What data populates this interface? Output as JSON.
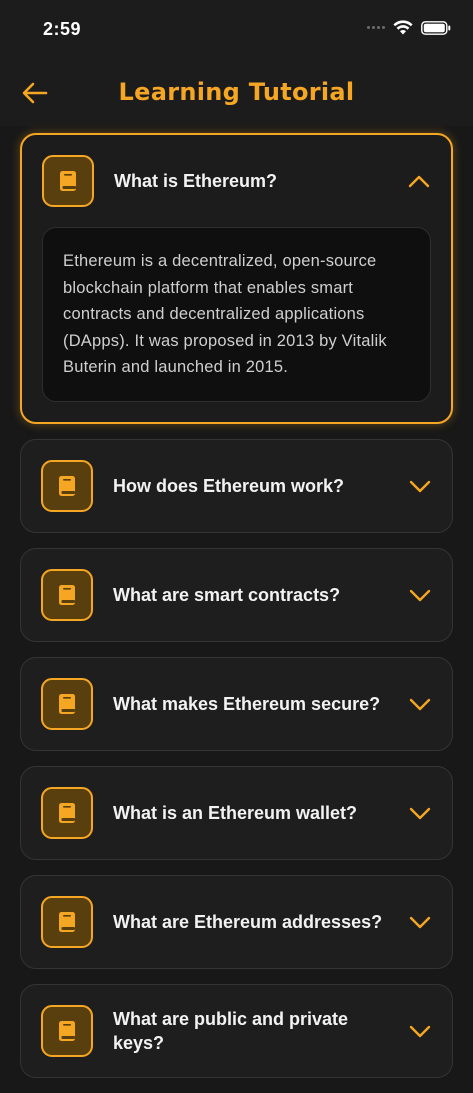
{
  "status": {
    "time": "2:59"
  },
  "header": {
    "title": "Learning Tutorial",
    "back_icon": "arrow-left-icon"
  },
  "colors": {
    "accent": "#f5a623",
    "background": "#181818",
    "card": "#1e1e1e"
  },
  "faq": [
    {
      "question": "What is Ethereum?",
      "expanded": true,
      "answer": "Ethereum is a decentralized, open-source blockchain platform that enables smart contracts and decentralized applications (DApps). It was proposed in 2013 by Vitalik Buterin and launched in 2015."
    },
    {
      "question": "How does Ethereum work?",
      "expanded": false
    },
    {
      "question": "What are smart contracts?",
      "expanded": false
    },
    {
      "question": "What makes Ethereum secure?",
      "expanded": false
    },
    {
      "question": "What is an Ethereum wallet?",
      "expanded": false
    },
    {
      "question": "What are Ethereum addresses?",
      "expanded": false
    },
    {
      "question": "What are public and private keys?",
      "expanded": false
    }
  ]
}
